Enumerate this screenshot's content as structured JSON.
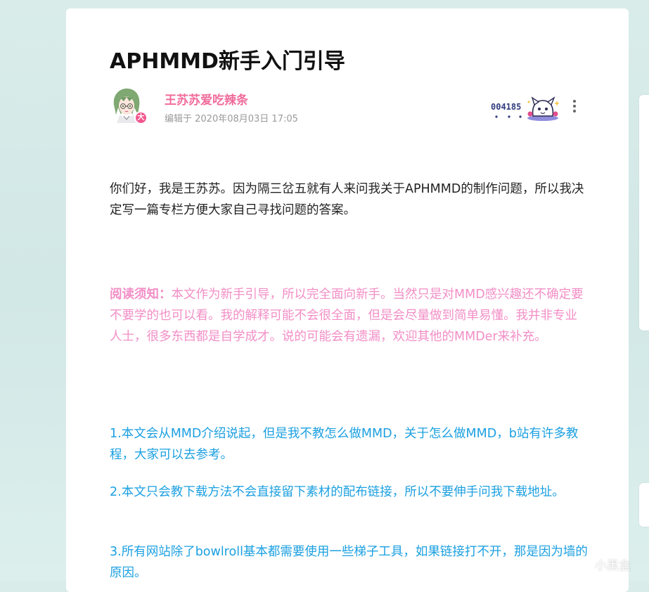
{
  "article": {
    "title": "APHMMD新手入门引导",
    "author": {
      "name": "王苏苏爱吃辣条",
      "badge": "大",
      "edit_time": "编辑于 2020年08月03日 17:05",
      "fan_number": "004185"
    },
    "paragraphs": {
      "intro": "你们好，我是王苏苏。因为隔三岔五就有人来问我关于APHMMD的制作问题，所以我决定写一篇专栏方便大家自己寻找问题的答案。",
      "notice_label": "阅读须知：",
      "notice_text": "本文作为新手引导，所以完全面向新手。当然只是对MMD感兴趣还不确定要不要学的也可以看。我的解释可能不会很全面，但是会尽量做到简单易懂。我并非专业人士，很多东西都是自学成才。说的可能会有遗漏，欢迎其他的MMDer来补充。",
      "item1": "1.本文会从MMD介绍说起，但是我不教怎么做MMD，关于怎么做MMD，b站有许多教程，大家可以去参考。",
      "item2": "2.本文只会教下载方法不会直接留下素材的配布链接，所以不要伸手问我下载地址。",
      "item3": "3.所有网站除了bowlroll基本都需要使用一些梯子工具，如果链接打不开，那是因为墙的原因。"
    }
  },
  "watermark": {
    "text": "小黑盒"
  },
  "icons": {
    "more": "more-vertical-icon",
    "avatar": "avatar-image",
    "fan_badge": "fan-badge-icon",
    "watermark_logo": "xiaoheihe-logo-icon"
  },
  "colors": {
    "author_name": "#f06b9a",
    "notice_text": "#f28ec6",
    "list_text": "#1ca0e1",
    "badge": "#f2568e",
    "background": "#d2e8e6"
  }
}
